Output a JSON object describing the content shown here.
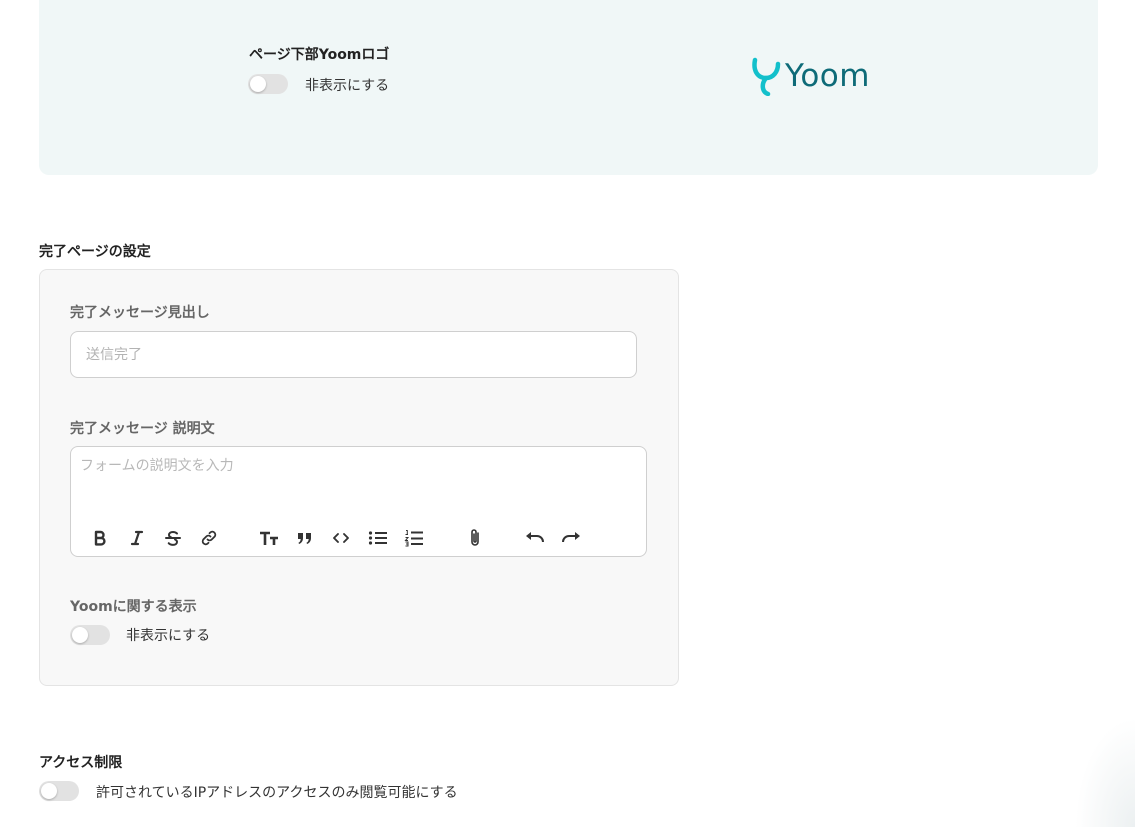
{
  "footer_logo": {
    "title": "ページ下部Yoomロゴ",
    "hide_label": "非表示にする",
    "logo_text": "Yoom",
    "accent_color": "#13c0cb"
  },
  "complete_page": {
    "section_title": "完了ページの設定",
    "heading_label": "完了メッセージ見出し",
    "heading_placeholder": "送信完了",
    "description_label": "完了メッセージ 説明文",
    "description_placeholder": "フォームの説明文を入力",
    "toolbar": [
      "bold-icon",
      "italic-icon",
      "strikethrough-icon",
      "link-icon",
      "heading-icon",
      "quote-icon",
      "code-icon",
      "bullet-list-icon",
      "numbered-list-icon",
      "attachment-icon",
      "undo-icon",
      "redo-icon"
    ],
    "yoom_display_label": "Yoomに関する表示",
    "yoom_hide_label": "非表示にする"
  },
  "access": {
    "section_title": "アクセス制限",
    "ip_restrict_label": "許可されているIPアドレスのアクセスのみ閲覧可能にする"
  }
}
